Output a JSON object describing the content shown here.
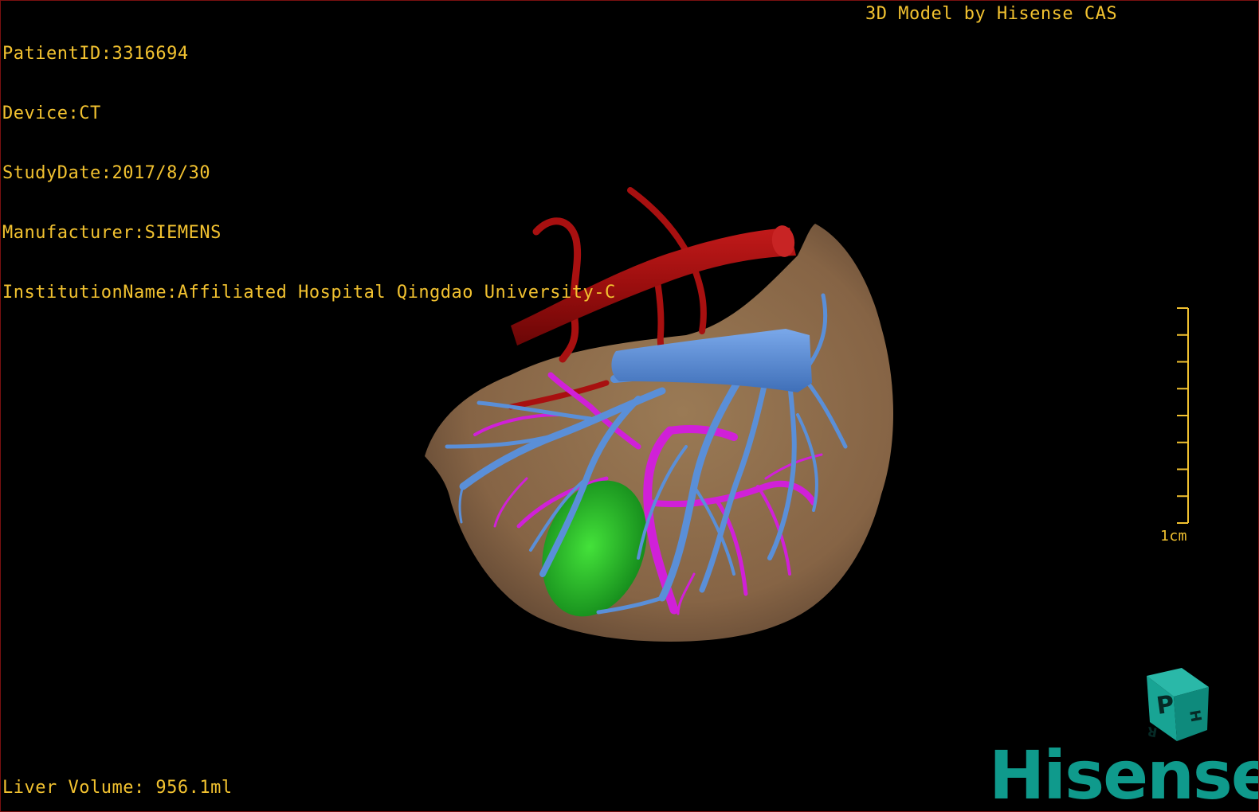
{
  "patient_info": {
    "patient_id": "PatientID:3316694",
    "device": "Device:CT",
    "study_date": "StudyDate:2017/8/30",
    "manufacturer": "Manufacturer:SIEMENS",
    "institution": "InstitutionName:Affiliated Hospital Qingdao University-C"
  },
  "brand_caption": "3D Model by Hisense CAS",
  "liver_volume": "Liver Volume: 956.1ml",
  "scale_bar": {
    "label": "1cm",
    "tick_count": 9
  },
  "orientation_cube": {
    "face_front": "P",
    "face_side_top": "H",
    "face_side_bottom": "R"
  },
  "logo_text": "Hisense",
  "colors": {
    "overlay_text": "#f2c230",
    "liver": "#8a6a47",
    "artery": "#b01414",
    "portal_vein": "#d020d8",
    "hepatic_vein": "#5a8fd8",
    "gallbladder": "#22c01e",
    "logo": "#0f9a8c",
    "border": "#7a1010"
  },
  "structures": [
    "liver-surface",
    "aorta",
    "hepatic-artery",
    "portal-vein",
    "hepatic-vein",
    "gallbladder"
  ]
}
